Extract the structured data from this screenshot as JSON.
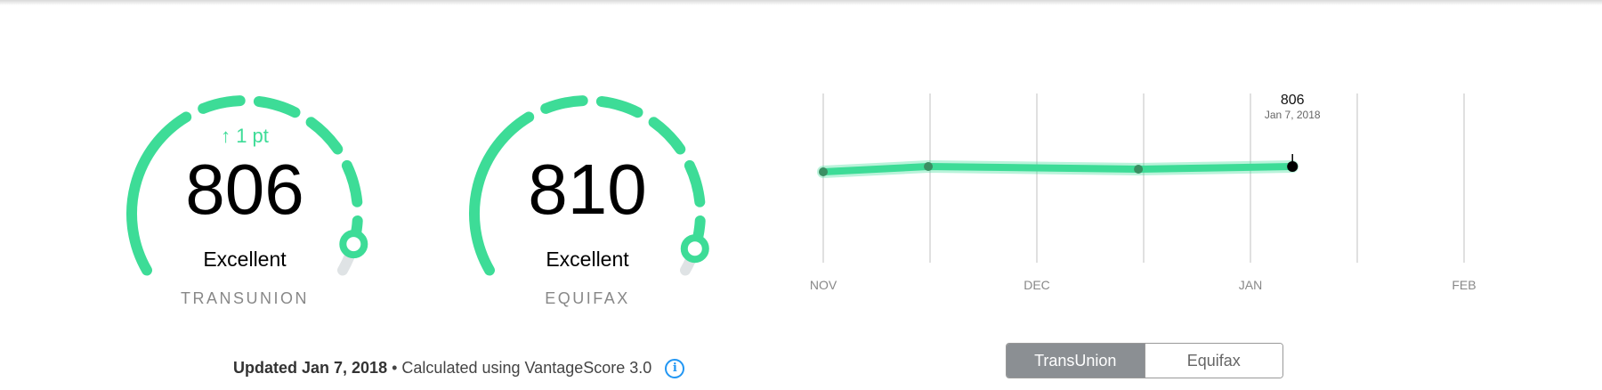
{
  "colors": {
    "accent": "#3ddc97",
    "gauge_track": "#dfe3e5",
    "info_blue": "#2196f3",
    "toggle_active_bg": "#8b8f93"
  },
  "gauges": [
    {
      "bureau": "TRANSUNION",
      "score": "806",
      "rating": "Excellent",
      "change": "↑ 1 pt",
      "level": 0.94
    },
    {
      "bureau": "EQUIFAX",
      "score": "810",
      "rating": "Excellent",
      "change": "",
      "level": 0.95
    }
  ],
  "chart_data": {
    "type": "line",
    "x_labels": [
      "NOV",
      "DEC",
      "JAN",
      "FEB"
    ],
    "x": [
      "Nov 1, 2017",
      "Nov 16, 2017",
      "Dec 16, 2017",
      "Jan 7, 2018"
    ],
    "series": [
      {
        "values": [
          804,
          806,
          805,
          806
        ]
      }
    ],
    "highlight": {
      "value": "806",
      "date": "Jan 7, 2018"
    },
    "grid": true
  },
  "footer": {
    "updated": "Updated Jan 7, 2018",
    "separator": "•",
    "note": "Calculated using VantageScore 3.0",
    "info_icon": "info-icon"
  },
  "toggle": {
    "options": [
      "TransUnion",
      "Equifax"
    ],
    "selected": "TransUnion"
  }
}
